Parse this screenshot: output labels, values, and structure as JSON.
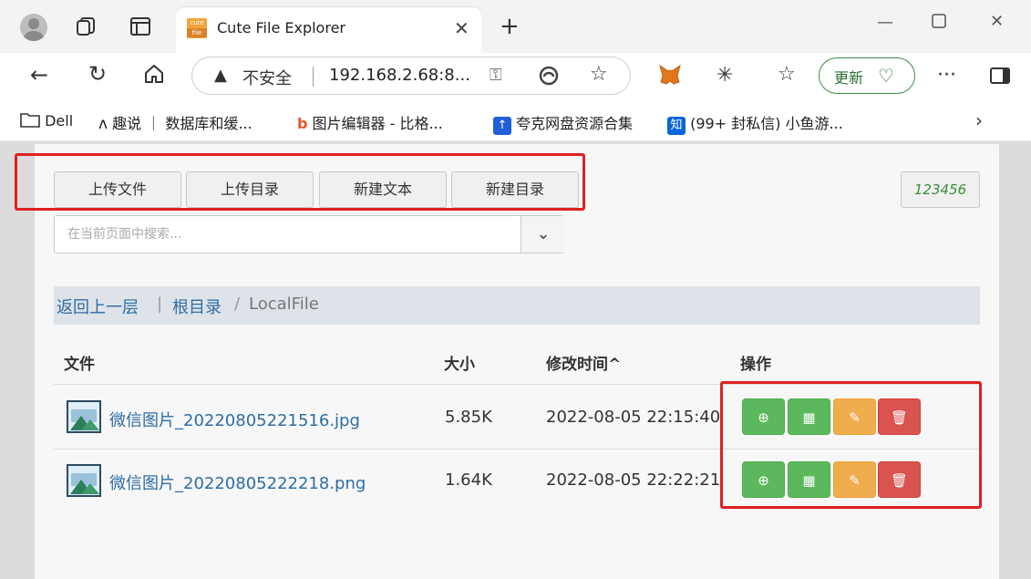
{
  "browser": {
    "tab": {
      "favicon_top": "cute",
      "favicon_bottom": "file",
      "title": "Cute File Explorer"
    },
    "address": {
      "security_label": "不安全",
      "url": "192.168.2.68:8..."
    },
    "update_label": "更新",
    "bookmarks": [
      {
        "label": "Dell",
        "icon": "folder-icon"
      },
      {
        "label": "趣说 ｜ 数据库和缓...",
        "icon": "bird-icon"
      },
      {
        "label": "图片编辑器 - 比格...",
        "icon": "b-logo-icon"
      },
      {
        "label": "夸克网盘资源合集",
        "icon": "quark-logo-icon"
      },
      {
        "label": "(99+ 封私信) 小鱼游...",
        "icon": "zhihu-logo-icon",
        "badge": "知"
      }
    ]
  },
  "toolbar": {
    "buttons": [
      "上传文件",
      "上传目录",
      "新建文本",
      "新建目录"
    ],
    "password_button": "123456"
  },
  "search": {
    "placeholder": "在当前页面中搜索..."
  },
  "breadcrumb": {
    "back": "返回上一层",
    "sep1": "|",
    "root": "根目录",
    "sep2": "/",
    "current": "LocalFile"
  },
  "table": {
    "headers": {
      "file": "文件",
      "size": "大小",
      "modified": "修改时间",
      "sort_indicator": "^",
      "actions": "操作"
    },
    "rows": [
      {
        "name": "微信图片_20220805221516.jpg",
        "size": "5.85K",
        "modified": "2022-08-05 22:15:40"
      },
      {
        "name": "微信图片_20220805222218.png",
        "size": "1.64K",
        "modified": "2022-08-05 22:22:21"
      }
    ],
    "action_icons": [
      "download-icon",
      "qrcode-icon",
      "rename-icon",
      "trash-icon"
    ]
  },
  "colors": {
    "link": "#2e6da4",
    "green": "#5cb85c",
    "orange": "#f0ad4e",
    "red": "#d9534f",
    "highlight": "#e02020"
  }
}
